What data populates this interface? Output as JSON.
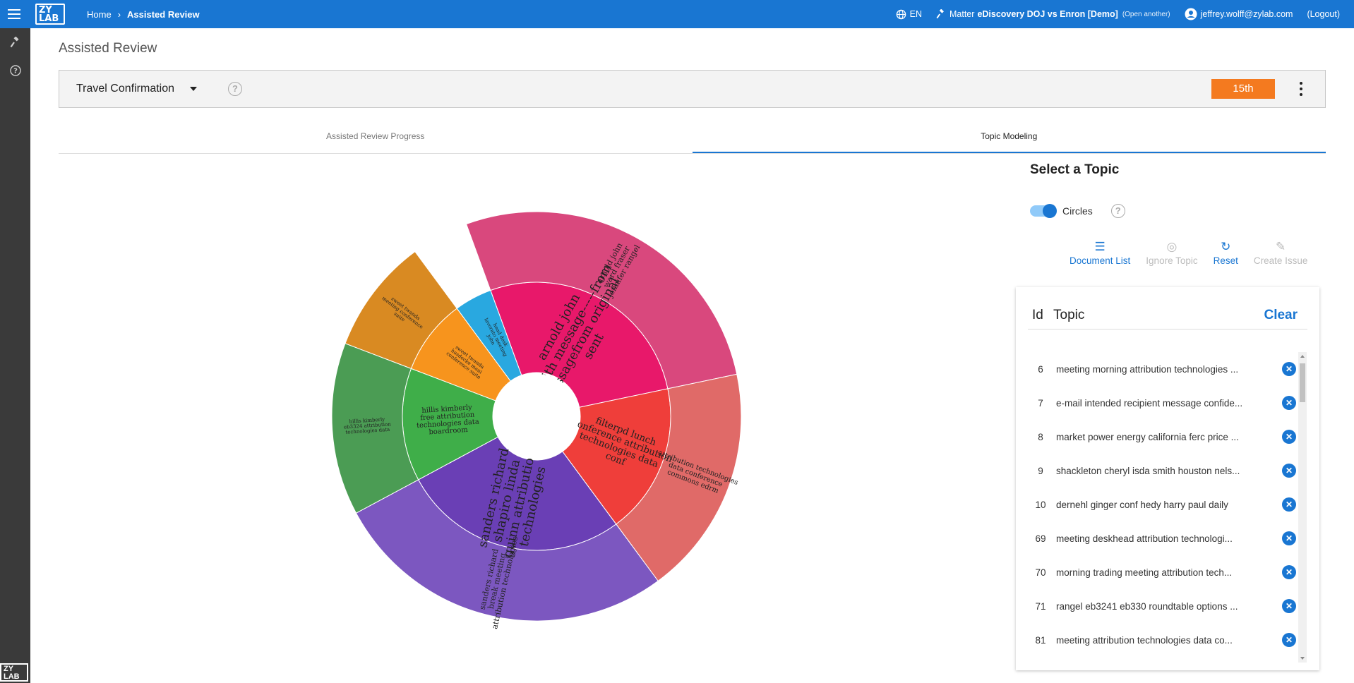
{
  "header": {
    "logo": "ZY LAB",
    "breadcrumb": [
      "Home",
      "Assisted Review"
    ],
    "language": "EN",
    "matter_label": "Matter",
    "matter_name": "eDiscovery DOJ vs Enron [Demo]",
    "open_another": "(Open another)",
    "user": "jeffrey.wolff@zylab.com",
    "logout": "(Logout)"
  },
  "sidebar": {
    "icons": [
      "gavel-icon",
      "help-icon"
    ],
    "logo": "ZY LAB"
  },
  "page": {
    "title": "Assisted Review",
    "selected_topic": "Travel Confirmation",
    "rank_badge": "15th"
  },
  "tabs": [
    {
      "label": "Assisted Review Progress",
      "active": false
    },
    {
      "label": "Topic Modeling",
      "active": true
    }
  ],
  "panel": {
    "title": "Select a Topic",
    "toggle_label": "Circles",
    "toggle_on": true,
    "actions": [
      {
        "label": "Document List",
        "icon": "list-icon",
        "glyph": "☰",
        "enabled": true
      },
      {
        "label": "Ignore Topic",
        "icon": "eye-off-icon",
        "glyph": "◎",
        "enabled": false
      },
      {
        "label": "Reset",
        "icon": "refresh-icon",
        "glyph": "↻",
        "enabled": true
      },
      {
        "label": "Create Issue",
        "icon": "pencil-icon",
        "glyph": "✎",
        "enabled": false
      }
    ],
    "table": {
      "col_id": "Id",
      "col_topic": "Topic",
      "clear_label": "Clear",
      "rows": [
        {
          "id": "6",
          "topic": "meeting morning attribution technologies ..."
        },
        {
          "id": "7",
          "topic": "e-mail intended recipient message confide..."
        },
        {
          "id": "8",
          "topic": "market power energy california ferc price ..."
        },
        {
          "id": "9",
          "topic": "shackleton cheryl isda smith houston nels..."
        },
        {
          "id": "10",
          "topic": "dernehl ginger conf hedy harry paul daily"
        },
        {
          "id": "69",
          "topic": "meeting deskhead attribution technologi..."
        },
        {
          "id": "70",
          "topic": "morning trading meeting attribution tech..."
        },
        {
          "id": "71",
          "topic": "rangel eb3241 eb330 roundtable options ..."
        },
        {
          "id": "81",
          "topic": "meeting attribution technologies data co..."
        }
      ]
    }
  },
  "sunburst": {
    "segments": [
      {
        "label": "arnold john griffith message-----from messagefrom original sent",
        "color": "#e8186a",
        "ring": 1,
        "weight": 18
      },
      {
        "label": "arnold john ward fraser jennifer rangel",
        "color": "#d9487d",
        "ring": 2,
        "weight": 10
      },
      {
        "label": "filterpd lunch conference attribution technologies data conf",
        "color": "#ef3e3a",
        "ring": 1,
        "weight": 12
      },
      {
        "label": "attribution technologies data conference commons edrm",
        "color": "#e06a68",
        "ring": 2,
        "weight": 9
      },
      {
        "label": "sanders richard shapiro linda guinn attribution technologies",
        "color": "#6a3fb5",
        "ring": 1,
        "weight": 18
      },
      {
        "label": "sanders richard break meeting attribution technologies",
        "color": "#7c57c0",
        "ring": 2,
        "weight": 10
      },
      {
        "label": "hillis kimberly free attribution technologies data boardroom",
        "color": "#3fae49",
        "ring": 1,
        "weight": 9
      },
      {
        "label": "hillis kimberly eb3324 attribution technologies data",
        "color": "#4b9c54",
        "ring": 2,
        "weight": 6
      },
      {
        "label": "sweet twanda hasdecke maui conference suite",
        "color": "#f7941d",
        "ring": 1,
        "weight": 6
      },
      {
        "label": "sweet twanda meeting conference suite",
        "color": "#d98a22",
        "ring": 2,
        "weight": 5
      },
      {
        "label": "head desk lavorato meeting john",
        "color": "#29a8e0",
        "ring": 1,
        "weight": 3
      }
    ]
  }
}
